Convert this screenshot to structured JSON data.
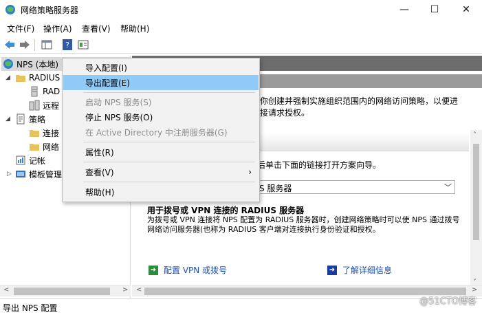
{
  "window": {
    "title": "网络策略服务器",
    "min_glyph": "—",
    "max_glyph": "☐",
    "close_glyph": "✕"
  },
  "menubar": {
    "items": [
      "文件(F)",
      "操作(A)",
      "查看(V)",
      "帮助(H)"
    ]
  },
  "toolbar": {
    "buttons": [
      "back-icon",
      "forward-icon",
      "show-hide-tree-icon",
      "help-icon",
      "properties-icon"
    ]
  },
  "tree": {
    "root": "NPS (本地)",
    "radius_group": "RADIUS",
    "radius_child_1": "RAD",
    "radius_child_2": "远程",
    "policies": "策略",
    "policies_child_1": "连接",
    "policies_child_2": "网络",
    "accounting": "记帐",
    "templates": "模板管理"
  },
  "context_menu": {
    "items": [
      "导入配置(I)",
      "导出配置(E)",
      "启动 NPS 服务(S)",
      "停止 NPS 服务(O)",
      "在 Active Directory 中注册服务器(G)",
      "属性(R)",
      "查看(V)",
      "帮助(H)"
    ],
    "highlighted": "导出配置(E)",
    "disabled": [
      "启动 NPS 服务(S)",
      "在 Active Directory 中注册服务器(G)"
    ]
  },
  "details": {
    "intro_line1": "你创建并强制实施组织范围内的网络访问策略，以便进",
    "intro_line2": "接请求授权。",
    "wizard_hint": "后单击下面的链接打开方案向导。",
    "scenario_value": "S 服务器",
    "option_title": "用于拨号或 VPN 连接的 RADIUS 服务器",
    "option_desc_line1": "为拨号或 VPN 连接将 NPS 配置为 RADIUS 服务器时，创建网络策略时可以使 NPS 通过拨号",
    "option_desc_line2": "网络访问服务器(也称为 RADIUS 客户端对连接执行身份验证和授权。",
    "link_configure": "配置 VPN 或拨号",
    "link_learn_more": "了解详细信息"
  },
  "statusbar": {
    "text": "导出 NPS 配置"
  },
  "watermark": "@51CTO博客",
  "colors": {
    "highlight": "#91c9f7",
    "header_dark": "#6d6d6d",
    "link": "#1a4fae"
  }
}
